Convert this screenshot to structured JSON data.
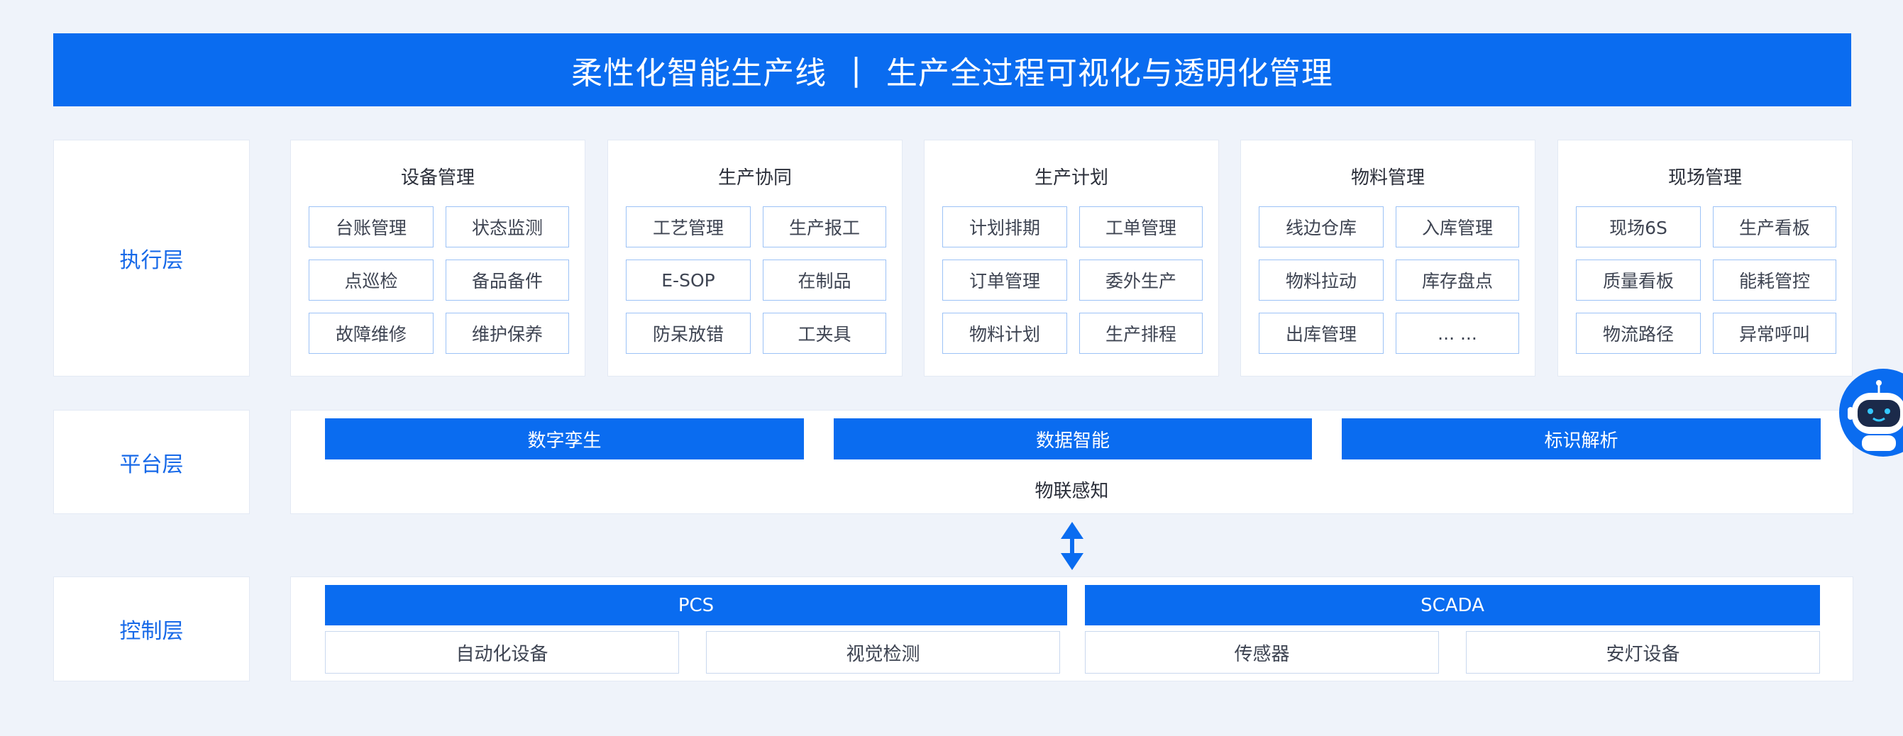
{
  "banner": {
    "title_left": "柔性化智能生产线",
    "separator": "|",
    "title_right": "生产全过程可视化与透明化管理"
  },
  "layers": {
    "execution": "执行层",
    "platform": "平台层",
    "control": "控制层"
  },
  "execution_cards": [
    {
      "title": "设备管理",
      "items": [
        "台账管理",
        "状态监测",
        "点巡检",
        "备品备件",
        "故障维修",
        "维护保养"
      ]
    },
    {
      "title": "生产协同",
      "items": [
        "工艺管理",
        "生产报工",
        "E-SOP",
        "在制品",
        "防呆放错",
        "工夹具"
      ]
    },
    {
      "title": "生产计划",
      "items": [
        "计划排期",
        "工单管理",
        "订单管理",
        "委外生产",
        "物料计划",
        "生产排程"
      ]
    },
    {
      "title": "物料管理",
      "items": [
        "线边仓库",
        "入库管理",
        "物料拉动",
        "库存盘点",
        "出库管理",
        "... ..."
      ]
    },
    {
      "title": "现场管理",
      "items": [
        "现场6S",
        "生产看板",
        "质量看板",
        "能耗管控",
        "物流路径",
        "异常呼叫"
      ]
    }
  ],
  "platform": {
    "bars": [
      "数字孪生",
      "数据智能",
      "标识解析"
    ],
    "iot_label": "物联感知"
  },
  "control": {
    "systems": [
      "PCS",
      "SCADA"
    ],
    "devices": [
      "自动化设备",
      "视觉检测",
      "传感器",
      "安灯设备"
    ]
  },
  "colors": {
    "primary": "#0a6cf0",
    "label_text": "#1769e8",
    "chip_border": "#9cc2f6",
    "background": "#eff3fa"
  },
  "icons": {
    "arrow": "double-arrow-icon",
    "assistant": "robot-assistant-icon"
  }
}
